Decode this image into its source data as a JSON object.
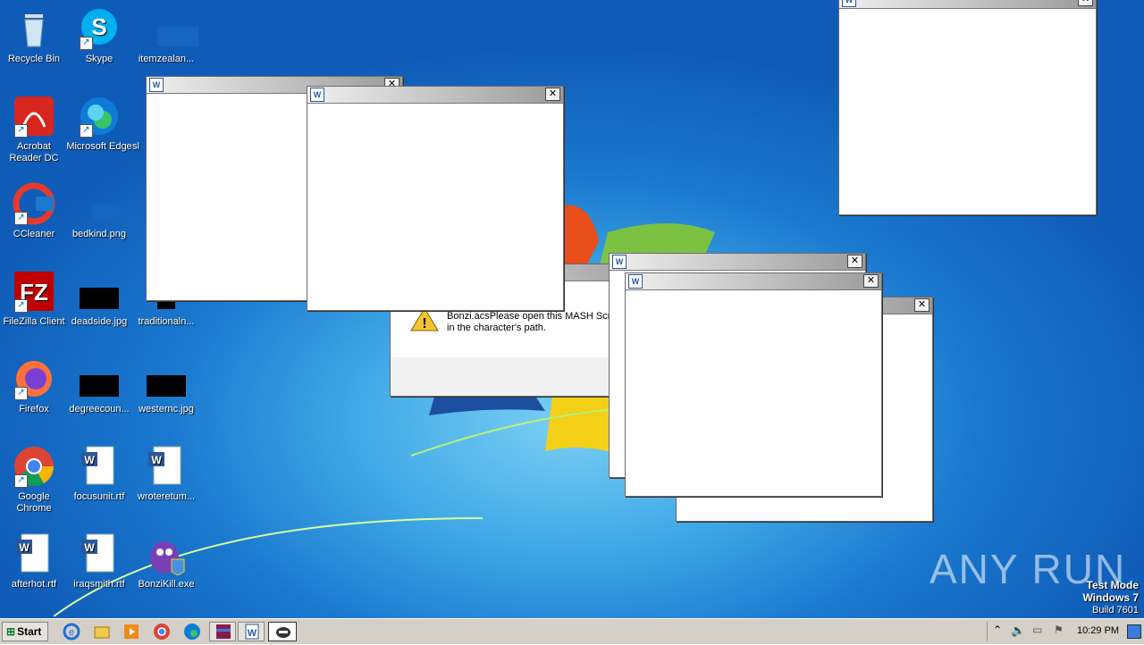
{
  "desktop_icons": [
    {
      "label": "Recycle Bin",
      "icon": "recycle-bin-icon"
    },
    {
      "label": "Skype",
      "icon": "skype-icon"
    },
    {
      "label": "itemzealan...",
      "icon": "image-file-icon"
    },
    {
      "label": "Acrobat Reader DC",
      "icon": "acrobat-icon"
    },
    {
      "label": "Microsoft Edge",
      "icon": "edge-icon"
    },
    {
      "label": "sl",
      "icon": "file-icon"
    },
    {
      "label": "CCleaner",
      "icon": "ccleaner-icon"
    },
    {
      "label": "bedkind.png",
      "icon": "image-file-icon"
    },
    {
      "label": "FileZilla Client",
      "icon": "filezilla-icon"
    },
    {
      "label": "deadside.jpg",
      "icon": "image-file-icon"
    },
    {
      "label": "traditionaln...",
      "icon": "image-file-icon"
    },
    {
      "label": "Firefox",
      "icon": "firefox-icon"
    },
    {
      "label": "degreecoun...",
      "icon": "image-file-icon"
    },
    {
      "label": "westernc.jpg",
      "icon": "image-file-icon"
    },
    {
      "label": "Google Chrome",
      "icon": "chrome-icon"
    },
    {
      "label": "focusunit.rtf",
      "icon": "word-doc-icon"
    },
    {
      "label": "wroteretum...",
      "icon": "word-doc-icon"
    },
    {
      "label": "afterhot.rtf",
      "icon": "word-doc-icon"
    },
    {
      "label": "iraqsmith.rtf",
      "icon": "word-doc-icon"
    },
    {
      "label": "BonziKill.exe",
      "icon": "bonzi-icon"
    }
  ],
  "error_dialog": {
    "message": "Error loading Bonzi. From Bonzi.acsPlease open this MASH Script in the character's path."
  },
  "watermark": {
    "brand": "ANY RUN"
  },
  "test_mode": {
    "line1": "Test Mode",
    "line2": "Windows 7",
    "line3": "Build 7601"
  },
  "taskbar": {
    "start_label": "Start",
    "clock": "10:29 PM",
    "quick_launch": [
      "ie-icon",
      "explorer-icon",
      "media-player-icon",
      "chrome-icon",
      "edge-icon",
      "winrar-icon",
      "word-icon",
      "bonzi-task-icon"
    ]
  },
  "colors": {
    "desktop": "#1a78cf",
    "taskbar": "#d4d0c8",
    "title_gradient_end": "#9a9a9a"
  }
}
